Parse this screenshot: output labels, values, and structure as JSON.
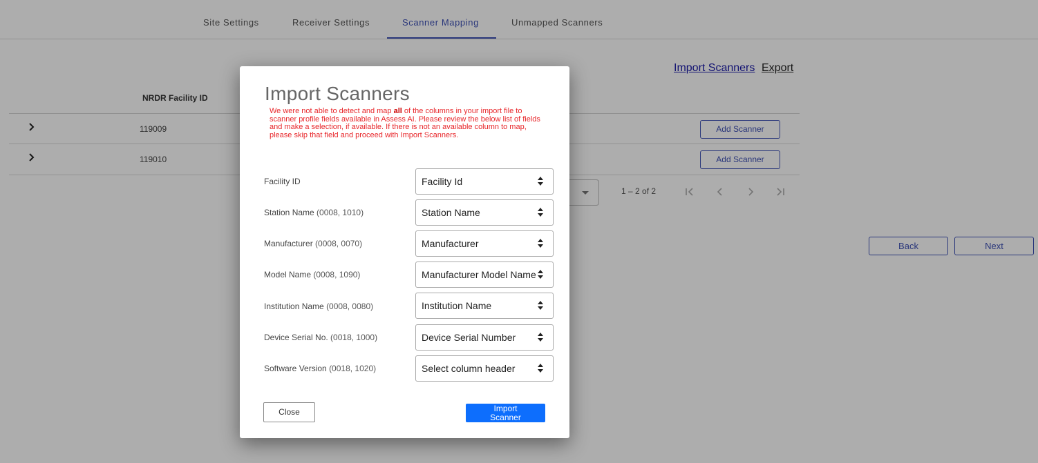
{
  "tabs": [
    {
      "label": "Site Settings",
      "active": false
    },
    {
      "label": "Receiver Settings",
      "active": false
    },
    {
      "label": "Scanner Mapping",
      "active": true
    },
    {
      "label": "Unmapped Scanners",
      "active": false
    }
  ],
  "top_links": {
    "import": "Import Scanners",
    "export": "Export"
  },
  "table": {
    "column_header": "NRDR Facility ID",
    "rows": [
      {
        "id": "119009",
        "action": "Add Scanner"
      },
      {
        "id": "119010",
        "action": "Add Scanner"
      }
    ]
  },
  "paginator": {
    "range_label": "1 – 2 of 2"
  },
  "footer_buttons": {
    "back": "Back",
    "next": "Next"
  },
  "dialog": {
    "title": "Import Scanners",
    "message_before": "We were not able to detect and map ",
    "message_bold": "all",
    "message_after": " of the columns in your import file to scanner profile fields available in Assess AI. Please review the below list of fields and make a selection, if available. If there is not an available column to map, please skip that field and proceed with Import Scanners.",
    "fields": [
      {
        "label": "Facility ID",
        "tag": "",
        "selected": "Facility Id"
      },
      {
        "label": "Station Name",
        "tag": "(0008, 1010)",
        "selected": "Station Name"
      },
      {
        "label": "Manufacturer",
        "tag": "(0008, 0070)",
        "selected": "Manufacturer"
      },
      {
        "label": "Model Name",
        "tag": "(0008, 1090)",
        "selected": "Manufacturer Model Name"
      },
      {
        "label": "Institution Name",
        "tag": "(0008, 0080)",
        "selected": "Institution Name"
      },
      {
        "label": "Device Serial No.",
        "tag": "(0018, 1000)",
        "selected": "Device Serial Number"
      },
      {
        "label": "Software Version",
        "tag": "(0018, 1020)",
        "selected": "Select column header"
      }
    ],
    "close_label": "Close",
    "import_label_line1": "Import",
    "import_label_line2": "Scanner"
  },
  "colors": {
    "accent": "#3f51b5",
    "primary_button": "#0d6efd",
    "warning_text": "#e8262a"
  },
  "icons": {
    "row_expand": "chevron-right-icon",
    "first_page": "first-page-icon",
    "prev_page": "chevron-left-icon",
    "next_page": "chevron-right-icon",
    "last_page": "last-page-icon",
    "select_arrows": "unfold-arrows-icon"
  }
}
